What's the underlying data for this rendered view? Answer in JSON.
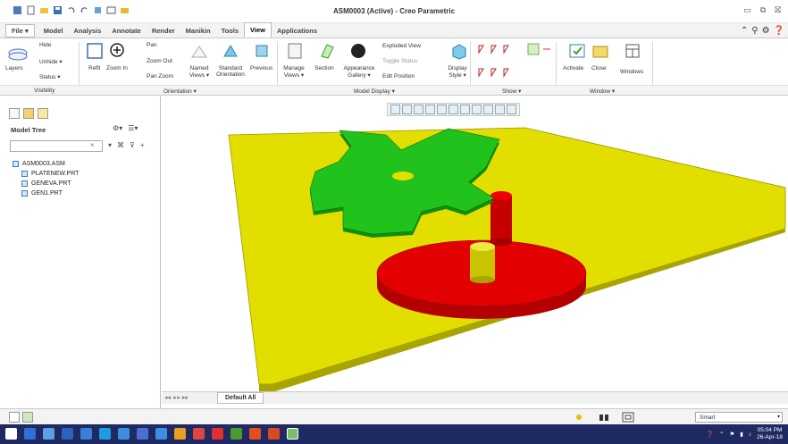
{
  "window": {
    "title": "ASM0003 (Active) - Creo Parametric"
  },
  "tabs": [
    {
      "label": "File ▾"
    },
    {
      "label": "Model"
    },
    {
      "label": "Analysis"
    },
    {
      "label": "Annotate"
    },
    {
      "label": "Render"
    },
    {
      "label": "Manikin"
    },
    {
      "label": "Tools"
    },
    {
      "label": "View"
    },
    {
      "label": "Applications"
    }
  ],
  "ribbon": {
    "visibility": {
      "hide": "Hide",
      "unhide": "Unhide ▾",
      "status": "Status ▾",
      "layers": "Layers"
    },
    "orientation": {
      "refit": "Refit",
      "zoom_in": "Zoom In",
      "pan": "Pan",
      "zoom_out": "Zoom Out",
      "pan_zoom": "Pan Zoom",
      "named_views": "Named Views ▾",
      "standard_orientation": "Standard Orientation",
      "previous": "Previous"
    },
    "model_display": {
      "manage_views": "Manage Views ▾",
      "section": "Section",
      "appearance_gallery": "Appearance Gallery ▾",
      "exploded_view": "Exploded View",
      "toggle_status": "Toggle Status",
      "edit_position": "Edit Position",
      "display_style": "Display Style ▾"
    },
    "window": {
      "activate": "Activate",
      "close": "Close",
      "windows": "Windows"
    },
    "groups": {
      "visibility": "Visibility",
      "orientation": "Orientation ▾",
      "model_display": "Model Display ▾",
      "show": "Show ▾",
      "window": "Window ▾"
    }
  },
  "model_tree": {
    "title": "Model Tree",
    "items": [
      {
        "label": "ASM0003.ASM"
      },
      {
        "label": "PLATENEW.PRT"
      },
      {
        "label": "GENEVA.PRT"
      },
      {
        "label": "GEN1.PRT"
      }
    ]
  },
  "bottom": {
    "default_tab": "Default All",
    "nav": "◂◂ ◂ ▸ ▸▸"
  },
  "status": {
    "filter": "Smart"
  },
  "clock": {
    "time": "05:04 PM",
    "date": "26-Apr-18"
  },
  "colors": {
    "plate": "#e2df00",
    "geneva": "#22c21c",
    "disk": "#e30000",
    "pin": "#d8d400"
  }
}
